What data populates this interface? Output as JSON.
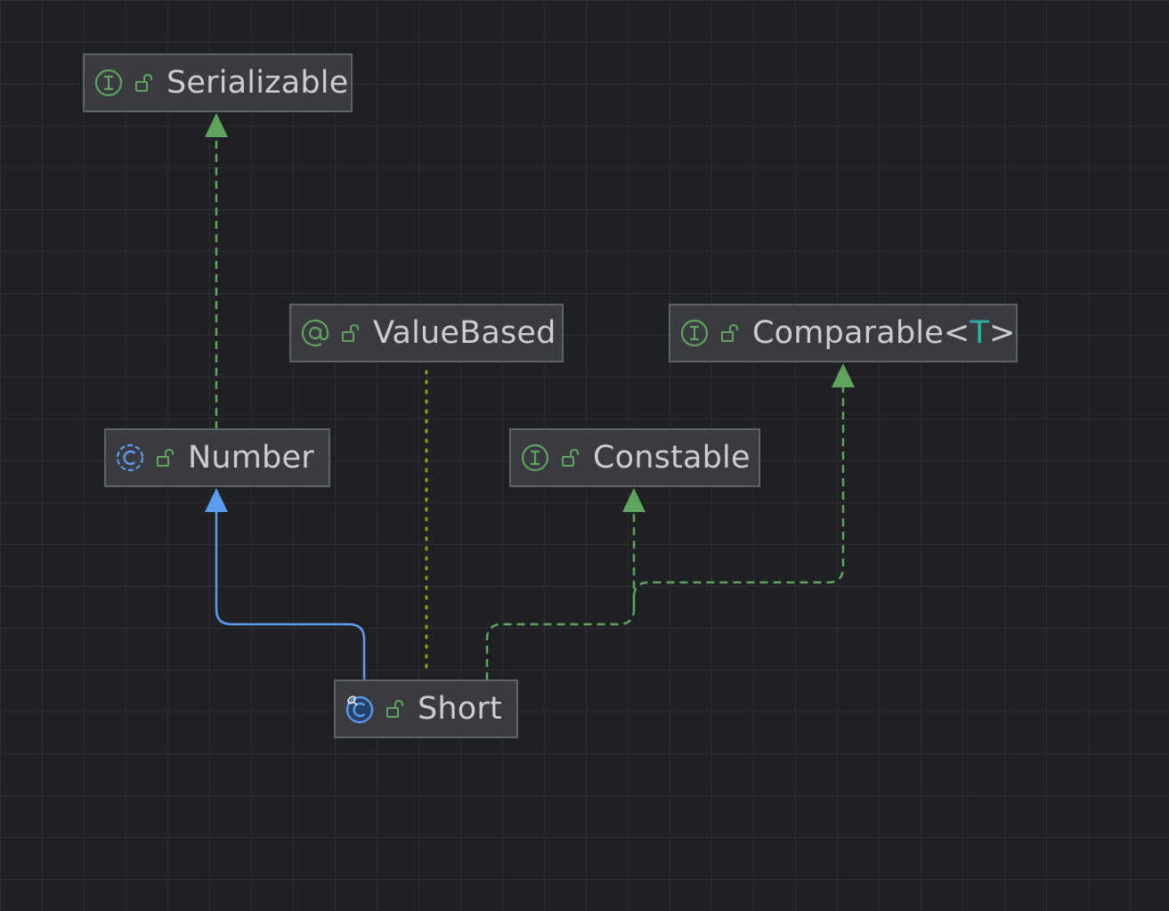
{
  "colors": {
    "background": "#1f2024",
    "grid": "#2b2d31",
    "node_bg": "#393b40",
    "node_border": "#5e6166",
    "text": "#cbcdd2",
    "type_param": "#2bb3a3",
    "interface_green": "#5fa35f",
    "class_blue": "#5b9cf0",
    "annotation_olive": "#9a9a1c"
  },
  "nodes": {
    "serializable": {
      "kind": "interface",
      "label": "Serializable"
    },
    "value_based": {
      "kind": "annotation",
      "label": "ValueBased"
    },
    "comparable": {
      "kind": "interface",
      "label": "Comparable<",
      "type_param": "T",
      "label_end": ">"
    },
    "number": {
      "kind": "abstract-class",
      "label": "Number"
    },
    "constable": {
      "kind": "interface",
      "label": "Constable"
    },
    "short": {
      "kind": "final-class",
      "label": "Short"
    }
  },
  "edges": [
    {
      "from": "Number",
      "to": "Serializable",
      "type": "implements"
    },
    {
      "from": "Short",
      "to": "Number",
      "type": "extends"
    },
    {
      "from": "Short",
      "to": "ValueBased",
      "type": "annotated-by"
    },
    {
      "from": "Short",
      "to": "Constable",
      "type": "implements"
    },
    {
      "from": "Short",
      "to": "Comparable<T>",
      "type": "implements"
    }
  ]
}
